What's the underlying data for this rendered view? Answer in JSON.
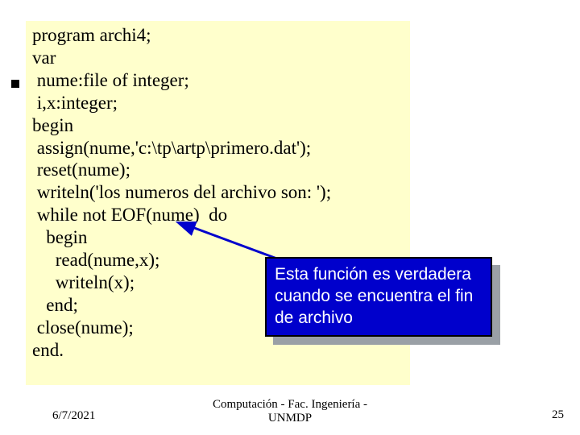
{
  "code": {
    "l1": "program archi4;",
    "l2": "var",
    "l3": " nume:file of integer;",
    "l4": " i,x:integer;",
    "l5": "begin",
    "l6": " assign(nume,'c:\\tp\\artp\\primero.dat');",
    "l7": " reset(nume);",
    "l8": " writeln('los numeros del archivo son: ');",
    "l9": " while not EOF(nume)  do",
    "l10": "   begin",
    "l11": "     read(nume,x);",
    "l12": "     writeln(x);",
    "l13": "   end;",
    "l14": " close(nume);",
    "l15": "end."
  },
  "callout": {
    "line1": "Esta función  es verdadera",
    "line2": "cuando se encuentra el fin",
    "line3": "de archivo"
  },
  "footer": {
    "date": "6/7/2021",
    "center_line1": "Computación - Fac. Ingeniería -",
    "center_line2": "UNMDP",
    "page": "25"
  }
}
